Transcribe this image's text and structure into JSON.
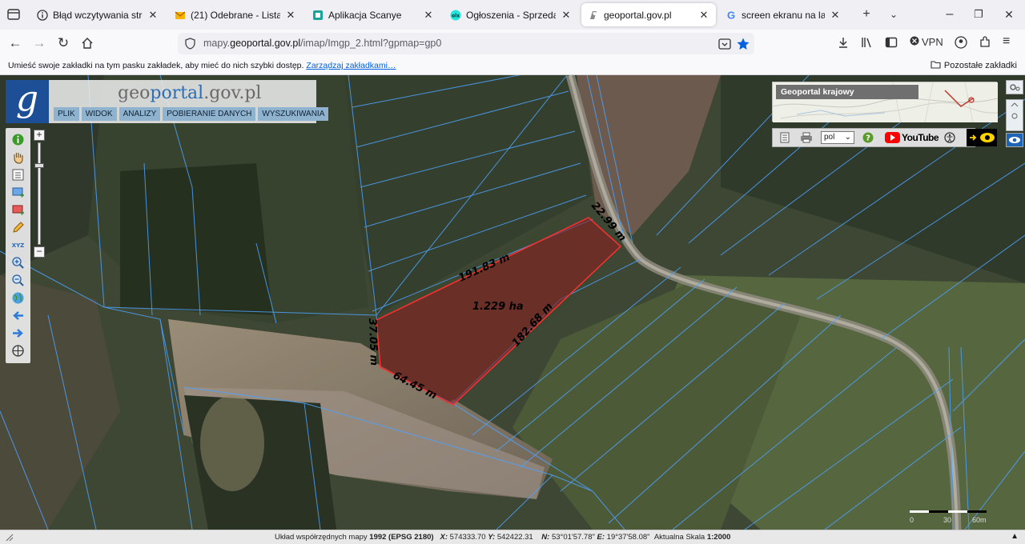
{
  "browser": {
    "tabs": [
      {
        "label": "Błąd wczytywania strony",
        "icon": "info-icon",
        "active": false
      },
      {
        "label": "(21) Odebrane - Lista Wiadomości",
        "icon": "mail-icon",
        "active": false
      },
      {
        "label": "Aplikacja Scanye",
        "icon": "scanye-icon",
        "active": false
      },
      {
        "label": "Ogłoszenia - Sprzedam, kupię",
        "icon": "olx-icon",
        "active": false
      },
      {
        "label": "geoportal.gov.pl",
        "icon": "geoportal-icon",
        "active": true
      },
      {
        "label": "screen ekranu na laptopie - Szukaj w Google",
        "icon": "google-icon",
        "active": false
      }
    ],
    "url_prefix": "mapy.",
    "url_domain": "geoportal.gov.pl",
    "url_path": "/imap/Imgp_2.html?gpmap=gp0",
    "vpn_label": "VPN",
    "bookmarks_message": "Umieść swoje zakładki na tym pasku zakładek, aby mieć do nich szybki dostęp.",
    "bookmarks_link": "Zarządzaj zakładkami…",
    "other_bookmarks": "Pozostałe zakładki"
  },
  "geoportal": {
    "logo_letter": "g",
    "logo_text_a": "geo",
    "logo_text_b": "portal",
    "logo_text_c": ".gov.pl",
    "menu": [
      "PLIK",
      "WIDOK",
      "ANALIZY",
      "POBIERANIE DANYCH",
      "WYSZUKIWANIA"
    ],
    "overview_title": "Geoportal krajowy",
    "language": "pol",
    "youtube_label": "YouTube"
  },
  "parcel": {
    "area_label": "1.229 ha",
    "edges": [
      "191.83 m",
      "22.99 m",
      "182.68 m",
      "64.45 m",
      "37.05 m"
    ],
    "overlay_color": "#8b1f22"
  },
  "scale_bar": {
    "start": "0",
    "mid": "30",
    "end": "60m"
  },
  "status": {
    "crs_label": "Układ współrzędnych mapy",
    "crs_value": "1992 (EPSG 2180)",
    "x_label": "X:",
    "x_value": "574333.70",
    "y_label": "Y:",
    "y_value": "542422.31",
    "n_label": "N:",
    "n_value": "53°01'57.78\"",
    "e_label": "E:",
    "e_value": "19°37'58.08\"",
    "scale_label": "Aktualna Skala",
    "scale_value": "1:2000"
  }
}
